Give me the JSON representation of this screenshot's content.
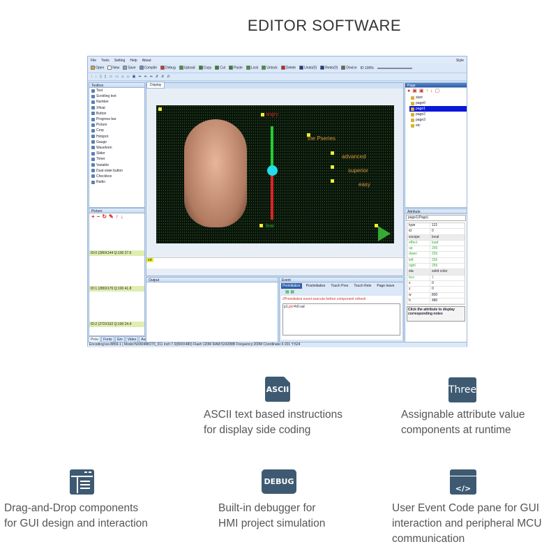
{
  "heading": "EDITOR SOFTWARE",
  "app": {
    "menu": [
      "File",
      "Tools",
      "Setting",
      "Help",
      "About"
    ],
    "style_label": "Style",
    "toolbar": [
      {
        "label": "Open",
        "color": "#e0a030"
      },
      {
        "label": "New",
        "color": "#ffffff"
      },
      {
        "label": "Save",
        "color": "#8aa0c0"
      },
      {
        "label": "Compile",
        "color": "#6a8cc0"
      },
      {
        "label": "Debug",
        "color": "#d03030"
      },
      {
        "label": "Upload",
        "color": "#3a9a3a"
      },
      {
        "label": "Copy",
        "color": "#2a8a2a"
      },
      {
        "label": "Cut",
        "color": "#2a8a2a"
      },
      {
        "label": "Paste",
        "color": "#2a8a2a"
      },
      {
        "label": "Lock",
        "color": "#3a9a3a"
      },
      {
        "label": "Unlock",
        "color": "#3a9a3a"
      },
      {
        "label": "Delete",
        "color": "#d02020"
      },
      {
        "label": "Undo(0)",
        "color": "#1a3a9a"
      },
      {
        "label": "Redo(0)",
        "color": "#1a3a9a"
      },
      {
        "label": "Device",
        "color": "#666666"
      }
    ],
    "device_id": "ID 100%",
    "toolbox": {
      "title": "Toolbox",
      "items": [
        "Text",
        "Scrolling text",
        "Number",
        "Xfloat",
        "Button",
        "Progress bar",
        "Picture",
        "Crop",
        "Hotspot",
        "Gauge",
        "Waveform",
        "Slider",
        "Timer",
        "Variable",
        "Dual-state button",
        "Checkbox",
        "Radio"
      ]
    },
    "picture": {
      "title": "Picture",
      "items": [
        "ID:0 (280X144 Q:100 27.6",
        "ID:1 (280X176 Q:100 41.8",
        "ID:2 (272X192 Q:100 24.4"
      ]
    },
    "bottom_tabs": [
      "Pictu",
      "Fonts",
      "Gm",
      "Video",
      "Audio"
    ],
    "display": {
      "tab": "Display",
      "texts": {
        "angry": "angry",
        "fear": "fear",
        "series": "the Pseries",
        "advanced": "advanced",
        "superior": "superior",
        "easy": "easy"
      },
      "footer_tag": "ed"
    },
    "output": {
      "title": "Output"
    },
    "event": {
      "title": "Event",
      "tabs": [
        "Preinitialize",
        "Postinitialize",
        "Touch Pres",
        "Touch Rele",
        "Page leave"
      ],
      "hint": "//Preinitialize event execute before component refresh",
      "code_a": "p1.",
      "code_b": "pic",
      "code_c": "=h0.val"
    },
    "page": {
      "title": "Page",
      "items": [
        "start",
        "page0",
        "page1",
        "page2",
        "page3",
        "etc"
      ],
      "selected": "page1"
    },
    "attribute": {
      "title": "Attribute",
      "object": "page1(Page)",
      "rows": [
        [
          "type",
          "121"
        ],
        [
          "id",
          "0"
        ],
        [
          "vscope",
          "local"
        ],
        [
          "effect",
          "load"
        ],
        [
          "up",
          "255"
        ],
        [
          "down",
          "255"
        ],
        [
          "left",
          "255"
        ],
        [
          "right",
          "255"
        ],
        [
          "sta",
          "solid color"
        ],
        [
          "bco",
          "1"
        ],
        [
          "x",
          "0"
        ],
        [
          "y",
          "0"
        ],
        [
          "w",
          "800"
        ],
        [
          "h",
          "480"
        ]
      ],
      "note": "Click the attribute to display corresponding notes"
    },
    "status": "Encoding:iso-8859-1 | Model:NX8048K070_011 inch:7.0(800X480) Flash:120M RAM:524288B Frequency:200M    Coordinate:X:201 Y:524",
    "colors": {
      "selected": "#0a18d8",
      "slider_top": "#22cc33",
      "slider_bottom": "#dd2222",
      "knob": "#22dde8"
    }
  },
  "features": [
    {
      "icon": "ASCII",
      "text1": "ASCII text based instructions",
      "text2": "for display side coding"
    },
    {
      "icon": "Three",
      "text1": "Assignable attribute value",
      "text2": "components at runtime"
    },
    {
      "icon": "layout",
      "text1": "Drag-and-Drop components",
      "text2": "for GUI design and interaction"
    },
    {
      "icon": "DEBUG",
      "text1": "Built-in debugger for",
      "text2": "HMI project simulation"
    },
    {
      "icon": "</>",
      "text1": "User Event Code pane for GUI",
      "text2": "interaction and peripheral MCU",
      "text3": "communication"
    }
  ]
}
